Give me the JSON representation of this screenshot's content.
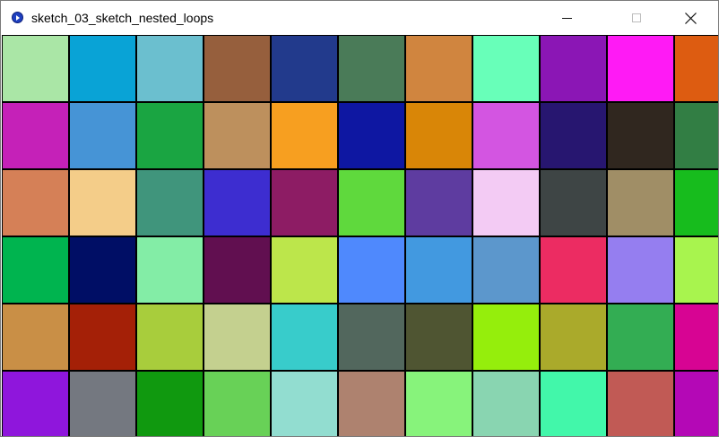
{
  "window": {
    "title": "sketch_03_sketch_nested_loops",
    "app_icon": "processing-icon",
    "controls": {
      "minimize": "minimize-icon",
      "maximize": "maximize-icon",
      "close": "close-icon"
    }
  },
  "canvas": {
    "rows": [
      [
        "#aae6a6",
        "#09a3d6",
        "#6bbfcf",
        "#965f3d",
        "#223a8c",
        "#4a7b58",
        "#d0853f",
        "#68ffb9",
        "#8b16b5",
        "#ff1af5",
        "#dd5c11"
      ],
      [
        "#c521b8",
        "#4694d6",
        "#1aa542",
        "#bd905d",
        "#f79f20",
        "#0e17a2",
        "#d98607",
        "#d355e1",
        "#271670",
        "#30271f",
        "#327e44"
      ],
      [
        "#d58057",
        "#f4cd89",
        "#40957c",
        "#3d2dd0",
        "#8d1c64",
        "#5fd93d",
        "#5e3ca0",
        "#f3cbf4",
        "#3e4545",
        "#a08e66",
        "#17bc1d"
      ],
      [
        "#00b44f",
        "#000e65",
        "#83eda6",
        "#610f50",
        "#bce64b",
        "#4f89fd",
        "#4299e0",
        "#5c97cc",
        "#ec2c62",
        "#957ef0",
        "#a8f44e"
      ],
      [
        "#c98f46",
        "#a42007",
        "#a8cd3c",
        "#c4d08f",
        "#38cccb",
        "#52675d",
        "#4f5532",
        "#95ee0c",
        "#aaaa2b",
        "#33ad53",
        "#d70493"
      ],
      [
        "#8f16dc",
        "#747880",
        "#10990f",
        "#68d157",
        "#92ddd0",
        "#ae826f",
        "#87f37b",
        "#89d5b1",
        "#42f7aa",
        "#c15a55",
        "#b408b6"
      ]
    ]
  }
}
